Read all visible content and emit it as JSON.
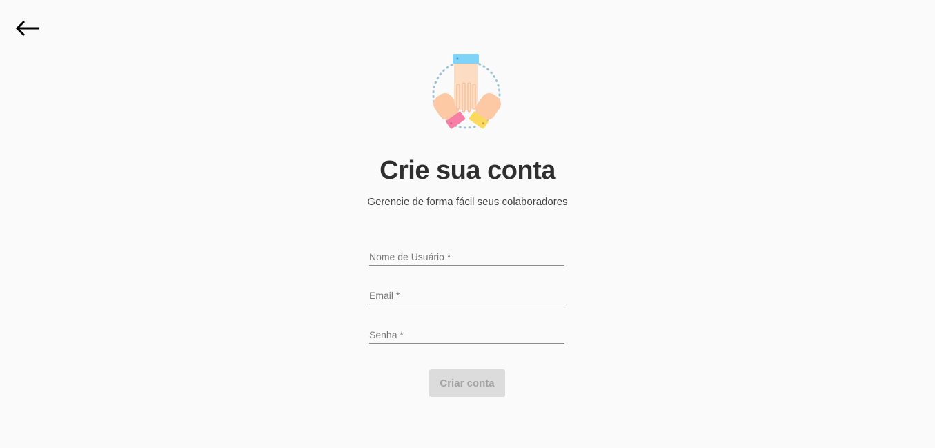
{
  "header": {
    "back_icon": "arrow-left-icon"
  },
  "hero": {
    "icon": "teamwork-hands-icon",
    "title": "Crie sua conta",
    "subtitle": "Gerencie de forma fácil seus colaboradores"
  },
  "form": {
    "fields": [
      {
        "label": "Nome de Usuário *",
        "value": ""
      },
      {
        "label": "Email *",
        "value": ""
      },
      {
        "label": "Senha *",
        "value": ""
      }
    ],
    "submit_label": "Criar conta"
  },
  "colors": {
    "background": "#fafafa",
    "title": "#2f2f2f",
    "button_disabled_bg": "#dcdcdc",
    "button_disabled_text": "#a3a3a3",
    "sleeve_blue": "#7fd3f7",
    "sleeve_pink": "#f77fa6",
    "sleeve_yellow": "#fcd85c",
    "skin": "#fcc9a4"
  }
}
